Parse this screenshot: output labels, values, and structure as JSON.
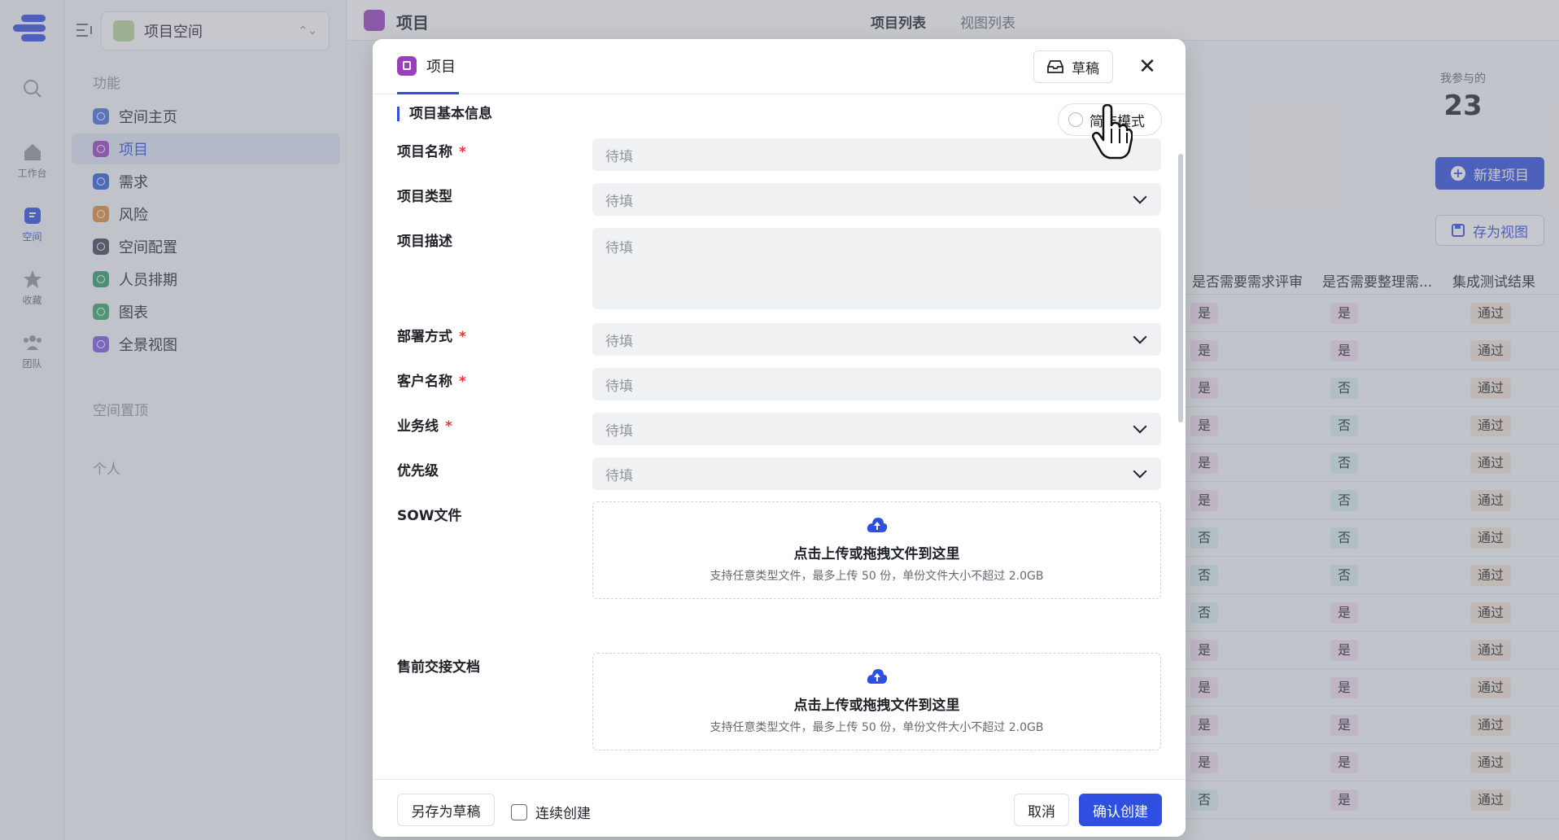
{
  "rail": {
    "items": [
      {
        "label": "",
        "icon": "search-icon"
      },
      {
        "label": "工作台",
        "icon": "home-icon"
      },
      {
        "label": "空间",
        "icon": "space-icon"
      },
      {
        "label": "收藏",
        "icon": "star-icon"
      },
      {
        "label": "团队",
        "icon": "team-icon"
      }
    ]
  },
  "sidebar": {
    "space_name": "项目空间",
    "section_features": "功能",
    "items": [
      {
        "label": "空间主页",
        "color": "#4a6ee0"
      },
      {
        "label": "项目",
        "color": "#9b3fbf"
      },
      {
        "label": "需求",
        "color": "#2f5fe0"
      },
      {
        "label": "风险",
        "color": "#e08a3a"
      },
      {
        "label": "空间配置",
        "color": "#3f4755"
      },
      {
        "label": "人员排期",
        "color": "#2f9b6a"
      },
      {
        "label": "图表",
        "color": "#3aa66a"
      },
      {
        "label": "全景视图",
        "color": "#7b5ae0"
      }
    ],
    "section_pinned": "空间置顶",
    "section_personal": "个人"
  },
  "main": {
    "title": "项目",
    "tabs": [
      "项目列表",
      "视图列表"
    ],
    "stat_label": "我参与的",
    "stat_value": "23",
    "new_button": "新建项目",
    "save_view_button": "存为视图",
    "columns": [
      "是否需要需求评审",
      "是否需要整理需...",
      "集成测试结果"
    ],
    "rows": [
      [
        "是",
        "是",
        "通过"
      ],
      [
        "是",
        "是",
        "通过"
      ],
      [
        "是",
        "否",
        "通过"
      ],
      [
        "是",
        "否",
        "通过"
      ],
      [
        "是",
        "否",
        "通过"
      ],
      [
        "是",
        "否",
        "通过"
      ],
      [
        "否",
        "否",
        "通过"
      ],
      [
        "否",
        "否",
        "通过"
      ],
      [
        "否",
        "是",
        "通过"
      ],
      [
        "是",
        "是",
        "通过"
      ],
      [
        "是",
        "是",
        "通过"
      ],
      [
        "是",
        "是",
        "通过"
      ],
      [
        "是",
        "是",
        "通过"
      ],
      [
        "否",
        "是",
        "通过"
      ]
    ]
  },
  "modal": {
    "tab_label": "项目",
    "draft_button": "草稿",
    "section_title": "项目基本信息",
    "simple_mode_label": "简洁模式",
    "fields": [
      {
        "label": "项目名称",
        "required": true,
        "placeholder": "待填",
        "type": "input"
      },
      {
        "label": "项目类型",
        "required": false,
        "placeholder": "待填",
        "type": "select"
      },
      {
        "label": "项目描述",
        "required": false,
        "placeholder": "待填",
        "type": "textarea"
      },
      {
        "label": "部署方式",
        "required": true,
        "placeholder": "待填",
        "type": "select"
      },
      {
        "label": "客户名称",
        "required": true,
        "placeholder": "待填",
        "type": "input"
      },
      {
        "label": "业务线",
        "required": true,
        "placeholder": "待填",
        "type": "select"
      },
      {
        "label": "优先级",
        "required": false,
        "placeholder": "待填",
        "type": "select"
      }
    ],
    "uploads": [
      {
        "label": "SOW文件",
        "title": "点击上传或拖拽文件到这里",
        "hint": "支持任意类型文件，最多上传 50 份，单份文件大小不超过 2.0GB"
      },
      {
        "label": "售前交接文档",
        "title": "点击上传或拖拽文件到这里",
        "hint": "支持任意类型文件，最多上传 50 份，单份文件大小不超过 2.0GB"
      }
    ],
    "footer": {
      "save_draft": "另存为草稿",
      "continuous_create": "连续创建",
      "cancel": "取消",
      "confirm": "确认创建"
    }
  },
  "colors": {
    "accent": "#2f4fe0",
    "project": "#9b3fbf"
  }
}
